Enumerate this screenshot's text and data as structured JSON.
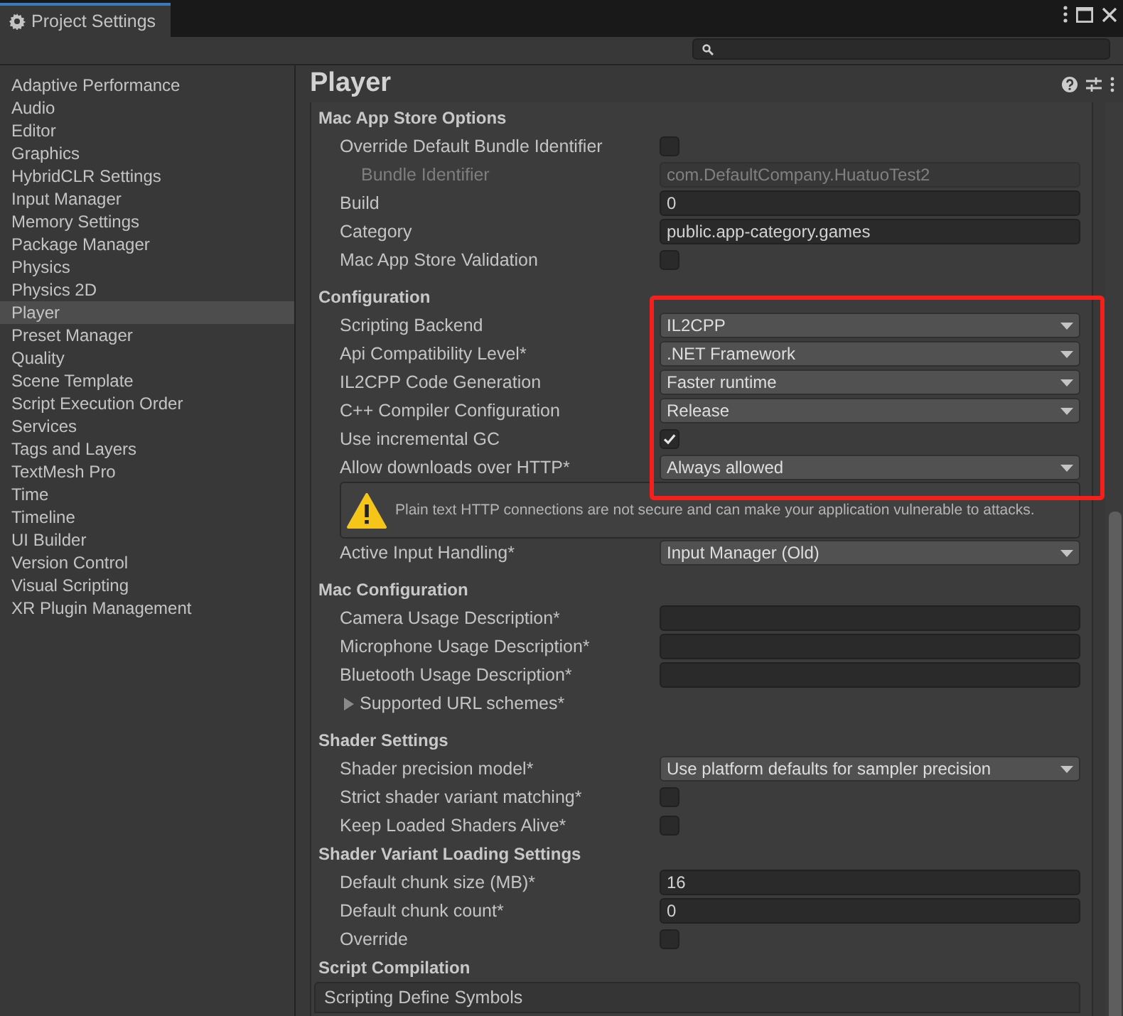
{
  "window": {
    "title": "Project Settings"
  },
  "sidebar": {
    "items": [
      {
        "label": "Adaptive Performance",
        "selected": false
      },
      {
        "label": "Audio",
        "selected": false
      },
      {
        "label": "Editor",
        "selected": false
      },
      {
        "label": "Graphics",
        "selected": false
      },
      {
        "label": "HybridCLR Settings",
        "selected": false
      },
      {
        "label": "Input Manager",
        "selected": false
      },
      {
        "label": "Memory Settings",
        "selected": false
      },
      {
        "label": "Package Manager",
        "selected": false
      },
      {
        "label": "Physics",
        "selected": false
      },
      {
        "label": "Physics 2D",
        "selected": false
      },
      {
        "label": "Player",
        "selected": true
      },
      {
        "label": "Preset Manager",
        "selected": false
      },
      {
        "label": "Quality",
        "selected": false
      },
      {
        "label": "Scene Template",
        "selected": false
      },
      {
        "label": "Script Execution Order",
        "selected": false
      },
      {
        "label": "Services",
        "selected": false
      },
      {
        "label": "Tags and Layers",
        "selected": false
      },
      {
        "label": "TextMesh Pro",
        "selected": false
      },
      {
        "label": "Time",
        "selected": false
      },
      {
        "label": "Timeline",
        "selected": false
      },
      {
        "label": "UI Builder",
        "selected": false
      },
      {
        "label": "Version Control",
        "selected": false
      },
      {
        "label": "Visual Scripting",
        "selected": false
      },
      {
        "label": "XR Plugin Management",
        "selected": false
      }
    ]
  },
  "panel": {
    "title": "Player",
    "sections": [
      {
        "title": "Mac App Store Options",
        "rows": [
          {
            "kind": "checkbox",
            "label": "Override Default Bundle Identifier",
            "checked": false
          },
          {
            "kind": "text",
            "label": "Bundle Identifier",
            "value": "com.DefaultCompany.HuatuoTest2",
            "disabled": true
          },
          {
            "kind": "text",
            "label": "Build",
            "value": "0",
            "disabled": false
          },
          {
            "kind": "text",
            "label": "Category",
            "value": "public.app-category.games",
            "disabled": false
          },
          {
            "kind": "checkbox",
            "label": "Mac App Store Validation",
            "checked": false
          }
        ]
      },
      {
        "title": "Configuration",
        "rows": [
          {
            "kind": "dropdown",
            "label": "Scripting Backend",
            "value": "IL2CPP"
          },
          {
            "kind": "dropdown",
            "label": "Api Compatibility Level*",
            "value": ".NET Framework"
          },
          {
            "kind": "dropdown",
            "label": "IL2CPP Code Generation",
            "value": "Faster runtime"
          },
          {
            "kind": "dropdown",
            "label": "C++ Compiler Configuration",
            "value": "Release"
          },
          {
            "kind": "checkbox",
            "label": "Use incremental GC",
            "checked": true
          },
          {
            "kind": "dropdown",
            "label": "Allow downloads over HTTP*",
            "value": "Always allowed"
          },
          {
            "kind": "warning",
            "text": "Plain text HTTP connections are not secure and can make your application vulnerable to attacks."
          },
          {
            "kind": "dropdown",
            "label": "Active Input Handling*",
            "value": "Input Manager (Old)"
          }
        ]
      },
      {
        "title": "Mac Configuration",
        "rows": [
          {
            "kind": "text",
            "label": "Camera Usage Description*",
            "disabled": false
          },
          {
            "kind": "text",
            "label": "Microphone Usage Description*",
            "disabled": false
          },
          {
            "kind": "text",
            "label": "Bluetooth Usage Description*",
            "disabled": false
          },
          {
            "kind": "foldout",
            "label": "Supported URL schemes*",
            "expanded": false
          }
        ]
      },
      {
        "title": "Shader Settings",
        "rows": [
          {
            "kind": "dropdown",
            "label": "Shader precision model*",
            "value": "Use platform defaults for sampler precision"
          },
          {
            "kind": "checkbox",
            "label": "Strict shader variant matching*",
            "checked": false
          },
          {
            "kind": "checkbox",
            "label": "Keep Loaded Shaders Alive*",
            "checked": false
          }
        ]
      },
      {
        "title": "Shader Variant Loading Settings",
        "rows": [
          {
            "kind": "text",
            "label": "Default chunk size (MB)*",
            "value": "16",
            "disabled": false
          },
          {
            "kind": "text",
            "label": "Default chunk count*",
            "value": "0",
            "disabled": false
          },
          {
            "kind": "checkbox",
            "label": "Override",
            "checked": false
          }
        ]
      },
      {
        "title": "Script Compilation",
        "rows": [
          {
            "kind": "list",
            "label": "Scripting Define Symbols"
          }
        ]
      }
    ]
  }
}
